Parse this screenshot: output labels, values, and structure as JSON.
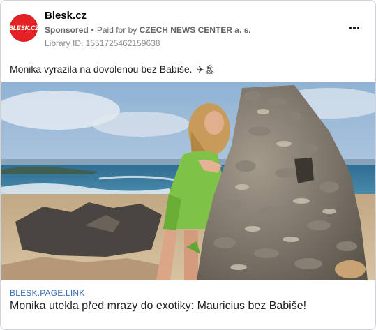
{
  "advertiser": {
    "avatar_text": "BLESK.CZ",
    "name": "Blesk.cz",
    "sponsored_label": "Sponsored",
    "separator": "•",
    "paid_for_prefix": "Paid for by",
    "paid_for_by": "CZECH NEWS CENTER a. s.",
    "library_id": "Library ID: 1551725462159638",
    "brand_color": "#e42226"
  },
  "post": {
    "text": "Monika vyrazila na dovolenou bez Babiše.",
    "emoji": "✈🏝"
  },
  "link_preview": {
    "domain": "BLESK.PAGE.LINK",
    "title": "Monika utekla před mrazy do exotiky: Mauricius bez Babiše!"
  },
  "icons": {
    "more": "more-options-icon"
  },
  "colors": {
    "link_domain": "#3a6fb0",
    "border": "#cfd3d8"
  }
}
